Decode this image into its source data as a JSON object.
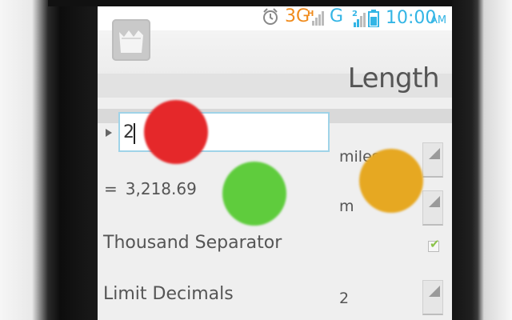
{
  "statusbar": {
    "network_3g": "3G",
    "network_3g_sub": "H",
    "network_g": "G",
    "network_g_sub": "2",
    "time": "10:00",
    "ampm": "AM",
    "accent_blue": "#33b5e5",
    "accent_orange": "#f08b1c",
    "icons": [
      "alarm-icon",
      "signal-icon",
      "battery-icon"
    ]
  },
  "actionbar": {
    "title": "Length",
    "app_icon": "app-logo-icon"
  },
  "converter": {
    "input_value": "2",
    "from_unit": "miles",
    "result_prefix": "=",
    "result_value": "3,218.69",
    "to_unit": "m"
  },
  "settings": {
    "thousand_separator_label": "Thousand Separator",
    "thousand_separator_checked": true,
    "limit_decimals_label": "Limit Decimals",
    "limit_decimals_value": "2"
  },
  "overlay_markers": {
    "colors": [
      "#e5282a",
      "#5fcc3d",
      "#e6a822"
    ]
  }
}
